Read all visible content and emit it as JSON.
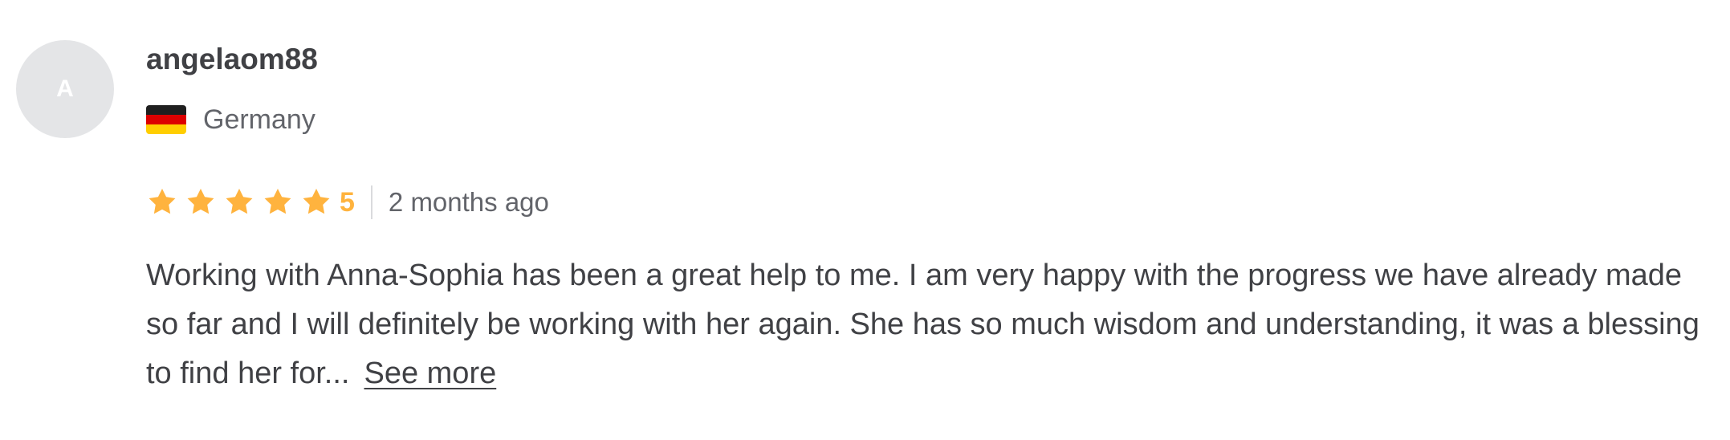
{
  "review": {
    "avatar_letter": "A",
    "username": "angelaom88",
    "country": "Germany",
    "flag_icon": "germany-flag-icon",
    "rating": {
      "value": 5,
      "label": "5",
      "max": 5,
      "star_icon": "star-icon",
      "star_color": "#ffb33e"
    },
    "time_ago": "2 months ago",
    "text": "Working with Anna-Sophia has been a great help to me. I am very happy with the progress we have already made so far and I will definitely be working with her again. She has so much wisdom and understanding, it was a blessing to find her for...",
    "see_more_label": "See more"
  },
  "colors": {
    "text_primary": "#404145",
    "text_secondary": "#62646a",
    "avatar_background": "#e4e5e7",
    "divider": "#dadbdd"
  }
}
